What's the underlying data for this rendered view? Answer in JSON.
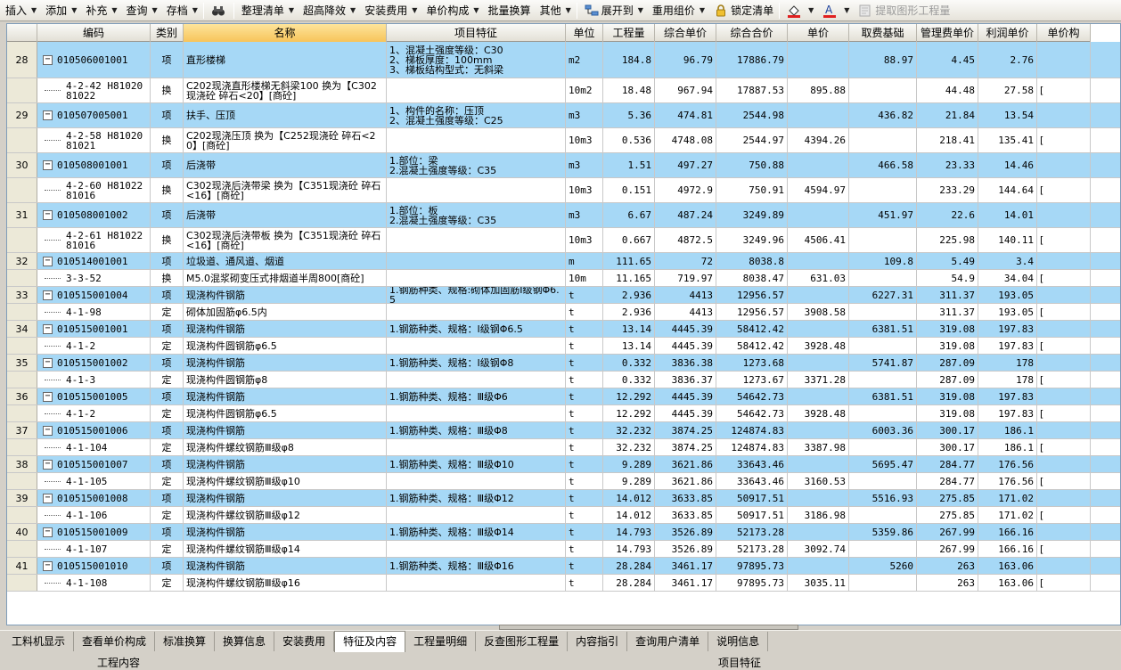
{
  "toolbar": {
    "items": [
      {
        "label": "插入",
        "arrow": true
      },
      {
        "label": "添加",
        "arrow": true
      },
      {
        "label": "补充",
        "arrow": true
      },
      {
        "label": "查询",
        "arrow": true
      },
      {
        "label": "存档",
        "arrow": true
      },
      {
        "label": "",
        "icon": "binoculars-icon"
      },
      {
        "label": "整理清单",
        "arrow": true
      },
      {
        "label": "超高降效",
        "arrow": true
      },
      {
        "label": "安装费用",
        "arrow": true
      },
      {
        "label": "单价构成",
        "arrow": true
      },
      {
        "label": "批量换算",
        "arrow": false
      },
      {
        "label": "其他",
        "arrow": true
      },
      {
        "label": "展开到",
        "arrow": true,
        "icon": "expand-tree-icon"
      },
      {
        "label": "重用组价",
        "arrow": true
      },
      {
        "label": "锁定清单",
        "arrow": false,
        "icon": "lock-icon"
      },
      {
        "label": "",
        "arrow": true,
        "icon": "fill-color-icon"
      },
      {
        "label": "",
        "arrow": true,
        "icon": "font-color-icon"
      },
      {
        "label": "提取图形工程量",
        "arrow": false,
        "icon": "extract-icon",
        "disabled": true
      }
    ]
  },
  "columns": [
    "",
    "编码",
    "类别",
    "名称",
    "项目特征",
    "单位",
    "工程量",
    "综合单价",
    "综合合价",
    "单价",
    "取费基础",
    "管理费单价",
    "利润单价",
    "单价构"
  ],
  "rows": [
    {
      "type": "item",
      "seq": "28",
      "code": "010506001001",
      "cat": "项",
      "name": "直形楼梯",
      "feature": "1、混凝土强度等级：C30\n2、梯板厚度：100mm\n3、梯板结构型式：无斜梁",
      "unit": "m2",
      "qty": "184.8",
      "up": "96.79",
      "total": "17886.79",
      "price": "",
      "base": "88.97",
      "mgmt": "4.45",
      "profit": "2.76",
      "extra": ""
    },
    {
      "type": "sub",
      "seq": "",
      "code": "4-2-42 H81020\n81022",
      "cat": "换",
      "name": "C202现浇直形楼梯无斜梁100  换为【C302现浇砼 碎石<20】[商砼]",
      "feature": "",
      "unit": "10m2",
      "qty": "18.48",
      "up": "967.94",
      "total": "17887.53",
      "price": "895.88",
      "base": "",
      "mgmt": "44.48",
      "profit": "27.58",
      "extra": "["
    },
    {
      "type": "item",
      "seq": "29",
      "code": "010507005001",
      "cat": "项",
      "name": "扶手、压顶",
      "feature": "1、构件的名称：压顶\n2、混凝土强度等级：C25",
      "unit": "m3",
      "qty": "5.36",
      "up": "474.81",
      "total": "2544.98",
      "price": "",
      "base": "436.82",
      "mgmt": "21.84",
      "profit": "13.54",
      "extra": ""
    },
    {
      "type": "sub",
      "seq": "",
      "code": "4-2-58 H81020\n81021",
      "cat": "换",
      "name": "C202现浇压顶  换为【C252现浇砼 碎石<20】[商砼]",
      "feature": "",
      "unit": "10m3",
      "qty": "0.536",
      "up": "4748.08",
      "total": "2544.97",
      "price": "4394.26",
      "base": "",
      "mgmt": "218.41",
      "profit": "135.41",
      "extra": "["
    },
    {
      "type": "item",
      "seq": "30",
      "code": "010508001001",
      "cat": "项",
      "name": "后浇带",
      "feature": "1.部位：梁\n2.混凝土强度等级：C35",
      "unit": "m3",
      "qty": "1.51",
      "up": "497.27",
      "total": "750.88",
      "price": "",
      "base": "466.58",
      "mgmt": "23.33",
      "profit": "14.46",
      "extra": ""
    },
    {
      "type": "sub",
      "seq": "",
      "code": "4-2-60 H81022\n81016",
      "cat": "换",
      "name": "C302现浇后浇带梁  换为【C351现浇砼 碎石<16】[商砼]",
      "feature": "",
      "unit": "10m3",
      "qty": "0.151",
      "up": "4972.9",
      "total": "750.91",
      "price": "4594.97",
      "base": "",
      "mgmt": "233.29",
      "profit": "144.64",
      "extra": "["
    },
    {
      "type": "item",
      "seq": "31",
      "code": "010508001002",
      "cat": "项",
      "name": "后浇带",
      "feature": "1.部位：板\n2.混凝土强度等级：C35",
      "unit": "m3",
      "qty": "6.67",
      "up": "487.24",
      "total": "3249.89",
      "price": "",
      "base": "451.97",
      "mgmt": "22.6",
      "profit": "14.01",
      "extra": ""
    },
    {
      "type": "sub",
      "seq": "",
      "code": "4-2-61 H81022\n81016",
      "cat": "换",
      "name": "C302现浇后浇带板  换为【C351现浇砼 碎石<16】[商砼]",
      "feature": "",
      "unit": "10m3",
      "qty": "0.667",
      "up": "4872.5",
      "total": "3249.96",
      "price": "4506.41",
      "base": "",
      "mgmt": "225.98",
      "profit": "140.11",
      "extra": "["
    },
    {
      "type": "item",
      "seq": "32",
      "code": "010514001001",
      "cat": "项",
      "name": "垃圾道、通风道、烟道",
      "feature": "",
      "unit": "m",
      "qty": "111.65",
      "up": "72",
      "total": "8038.8",
      "price": "",
      "base": "109.8",
      "mgmt": "5.49",
      "profit": "3.4",
      "extra": ""
    },
    {
      "type": "sub",
      "seq": "",
      "code": "3-3-52",
      "cat": "换",
      "name": "M5.0混浆砌变压式排烟道半周800[商砼]",
      "feature": "",
      "unit": "10m",
      "qty": "11.165",
      "up": "719.97",
      "total": "8038.47",
      "price": "631.03",
      "base": "",
      "mgmt": "54.9",
      "profit": "34.04",
      "extra": "["
    },
    {
      "type": "item",
      "seq": "33",
      "code": "010515001004",
      "cat": "项",
      "name": "现浇构件钢筋",
      "feature": "1.钢筋种类、规格:砌体加固筋Ⅰ级钢Φ6.5",
      "unit": "t",
      "qty": "2.936",
      "up": "4413",
      "total": "12956.57",
      "price": "",
      "base": "6227.31",
      "mgmt": "311.37",
      "profit": "193.05",
      "extra": ""
    },
    {
      "type": "sub",
      "seq": "",
      "code": "4-1-98",
      "cat": "定",
      "name": "砌体加固筋φ6.5内",
      "feature": "",
      "unit": "t",
      "qty": "2.936",
      "up": "4413",
      "total": "12956.57",
      "price": "3908.58",
      "base": "",
      "mgmt": "311.37",
      "profit": "193.05",
      "extra": "["
    },
    {
      "type": "item",
      "seq": "34",
      "code": "010515001001",
      "cat": "项",
      "name": "现浇构件钢筋",
      "feature": "1.钢筋种类、规格：Ⅰ级钢Φ6.5",
      "unit": "t",
      "qty": "13.14",
      "up": "4445.39",
      "total": "58412.42",
      "price": "",
      "base": "6381.51",
      "mgmt": "319.08",
      "profit": "197.83",
      "extra": ""
    },
    {
      "type": "sub",
      "seq": "",
      "code": "4-1-2",
      "cat": "定",
      "name": "现浇构件圆钢筋φ6.5",
      "feature": "",
      "unit": "t",
      "qty": "13.14",
      "up": "4445.39",
      "total": "58412.42",
      "price": "3928.48",
      "base": "",
      "mgmt": "319.08",
      "profit": "197.83",
      "extra": "["
    },
    {
      "type": "item",
      "seq": "35",
      "code": "010515001002",
      "cat": "项",
      "name": "现浇构件钢筋",
      "feature": "1.钢筋种类、规格：Ⅰ级钢Φ8",
      "unit": "t",
      "qty": "0.332",
      "up": "3836.38",
      "total": "1273.68",
      "price": "",
      "base": "5741.87",
      "mgmt": "287.09",
      "profit": "178",
      "extra": ""
    },
    {
      "type": "sub",
      "seq": "",
      "code": "4-1-3",
      "cat": "定",
      "name": "现浇构件圆钢筋φ8",
      "feature": "",
      "unit": "t",
      "qty": "0.332",
      "up": "3836.37",
      "total": "1273.67",
      "price": "3371.28",
      "base": "",
      "mgmt": "287.09",
      "profit": "178",
      "extra": "["
    },
    {
      "type": "item",
      "seq": "36",
      "code": "010515001005",
      "cat": "项",
      "name": "现浇构件钢筋",
      "feature": "1.钢筋种类、规格：Ⅲ级Φ6",
      "unit": "t",
      "qty": "12.292",
      "up": "4445.39",
      "total": "54642.73",
      "price": "",
      "base": "6381.51",
      "mgmt": "319.08",
      "profit": "197.83",
      "extra": ""
    },
    {
      "type": "sub",
      "seq": "",
      "code": "4-1-2",
      "cat": "定",
      "name": "现浇构件圆钢筋φ6.5",
      "feature": "",
      "unit": "t",
      "qty": "12.292",
      "up": "4445.39",
      "total": "54642.73",
      "price": "3928.48",
      "base": "",
      "mgmt": "319.08",
      "profit": "197.83",
      "extra": "["
    },
    {
      "type": "item",
      "seq": "37",
      "code": "010515001006",
      "cat": "项",
      "name": "现浇构件钢筋",
      "feature": "1.钢筋种类、规格：Ⅲ级Φ8",
      "unit": "t",
      "qty": "32.232",
      "up": "3874.25",
      "total": "124874.83",
      "price": "",
      "base": "6003.36",
      "mgmt": "300.17",
      "profit": "186.1",
      "extra": ""
    },
    {
      "type": "sub",
      "seq": "",
      "code": "4-1-104",
      "cat": "定",
      "name": "现浇构件螺纹钢筋Ⅲ级φ8",
      "feature": "",
      "unit": "t",
      "qty": "32.232",
      "up": "3874.25",
      "total": "124874.83",
      "price": "3387.98",
      "base": "",
      "mgmt": "300.17",
      "profit": "186.1",
      "extra": "["
    },
    {
      "type": "item",
      "seq": "38",
      "code": "010515001007",
      "cat": "项",
      "name": "现浇构件钢筋",
      "feature": "1.钢筋种类、规格：Ⅲ级Φ10",
      "unit": "t",
      "qty": "9.289",
      "up": "3621.86",
      "total": "33643.46",
      "price": "",
      "base": "5695.47",
      "mgmt": "284.77",
      "profit": "176.56",
      "extra": ""
    },
    {
      "type": "sub",
      "seq": "",
      "code": "4-1-105",
      "cat": "定",
      "name": "现浇构件螺纹钢筋Ⅲ级φ10",
      "feature": "",
      "unit": "t",
      "qty": "9.289",
      "up": "3621.86",
      "total": "33643.46",
      "price": "3160.53",
      "base": "",
      "mgmt": "284.77",
      "profit": "176.56",
      "extra": "["
    },
    {
      "type": "item",
      "seq": "39",
      "code": "010515001008",
      "cat": "项",
      "name": "现浇构件钢筋",
      "feature": "1.钢筋种类、规格：Ⅲ级Φ12",
      "unit": "t",
      "qty": "14.012",
      "up": "3633.85",
      "total": "50917.51",
      "price": "",
      "base": "5516.93",
      "mgmt": "275.85",
      "profit": "171.02",
      "extra": ""
    },
    {
      "type": "sub",
      "seq": "",
      "code": "4-1-106",
      "cat": "定",
      "name": "现浇构件螺纹钢筋Ⅲ级φ12",
      "feature": "",
      "unit": "t",
      "qty": "14.012",
      "up": "3633.85",
      "total": "50917.51",
      "price": "3186.98",
      "base": "",
      "mgmt": "275.85",
      "profit": "171.02",
      "extra": "["
    },
    {
      "type": "item",
      "seq": "40",
      "code": "010515001009",
      "cat": "项",
      "name": "现浇构件钢筋",
      "feature": "1.钢筋种类、规格：Ⅲ级Φ14",
      "unit": "t",
      "qty": "14.793",
      "up": "3526.89",
      "total": "52173.28",
      "price": "",
      "base": "5359.86",
      "mgmt": "267.99",
      "profit": "166.16",
      "extra": ""
    },
    {
      "type": "sub",
      "seq": "",
      "code": "4-1-107",
      "cat": "定",
      "name": "现浇构件螺纹钢筋Ⅲ级φ14",
      "feature": "",
      "unit": "t",
      "qty": "14.793",
      "up": "3526.89",
      "total": "52173.28",
      "price": "3092.74",
      "base": "",
      "mgmt": "267.99",
      "profit": "166.16",
      "extra": "["
    },
    {
      "type": "item",
      "seq": "41",
      "code": "010515001010",
      "cat": "项",
      "name": "现浇构件钢筋",
      "feature": "1.钢筋种类、规格：Ⅲ级Φ16",
      "unit": "t",
      "qty": "28.284",
      "up": "3461.17",
      "total": "97895.73",
      "price": "",
      "base": "5260",
      "mgmt": "263",
      "profit": "163.06",
      "extra": ""
    },
    {
      "type": "sub",
      "seq": "",
      "code": "4-1-108",
      "cat": "定",
      "name": "现浇构件螺纹钢筋Ⅲ级φ16",
      "feature": "",
      "unit": "t",
      "qty": "28.284",
      "up": "3461.17",
      "total": "97895.73",
      "price": "3035.11",
      "base": "",
      "mgmt": "263",
      "profit": "163.06",
      "extra": "["
    }
  ],
  "tabs": [
    "工料机显示",
    "查看单价构成",
    "标准换算",
    "换算信息",
    "安装费用",
    "特征及内容",
    "工程量明细",
    "反查图形工程量",
    "内容指引",
    "查询用户清单",
    "说明信息"
  ],
  "active_tab": "特征及内容",
  "bottom": {
    "left_label": "工程内容",
    "right_label": "项目特征"
  }
}
